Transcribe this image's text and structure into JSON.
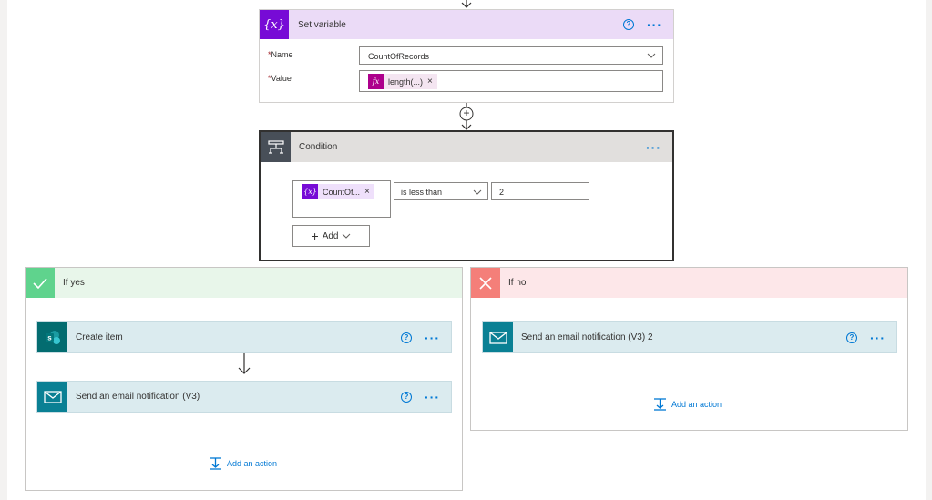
{
  "set_variable": {
    "title": "Set variable",
    "name_label": "Name",
    "name_value": "CountOfRecords",
    "value_label": "Value",
    "value_token": "length(...)",
    "icon_text": "{x}",
    "fx_text": "fx"
  },
  "condition": {
    "title": "Condition",
    "left_token": "CountOf...",
    "left_token_icon": "{x}",
    "operator": "is less than",
    "right_value": "2",
    "add_label": "Add"
  },
  "branch_yes": {
    "title": "If yes",
    "actions": [
      {
        "title": "Create item",
        "icon": "sharepoint-icon"
      },
      {
        "title": "Send an email notification (V3)",
        "icon": "mail-icon"
      }
    ],
    "add_action": "Add an action"
  },
  "branch_no": {
    "title": "If no",
    "actions": [
      {
        "title": "Send an email notification (V3) 2",
        "icon": "mail-icon"
      }
    ],
    "add_action": "Add an action"
  },
  "symbols": {
    "required": "*",
    "help": "?",
    "more": "···",
    "plus": "+",
    "close": "×",
    "sharepoint_letter": "s"
  },
  "colors": {
    "set_variable_header": "#ebdbf7",
    "variable_icon": "#770bd6",
    "fx_icon": "#ad008c",
    "condition_header": "#e1dfdd",
    "condition_icon": "#484f58",
    "yes_header": "#e8f6ea",
    "yes_icon": "#5fd38d",
    "no_header": "#fde7e9",
    "no_icon": "#f47f79",
    "action_header": "#dbebef",
    "sharepoint_icon": "#036c70",
    "mail_icon": "#0a8094",
    "link": "#0078d4"
  }
}
